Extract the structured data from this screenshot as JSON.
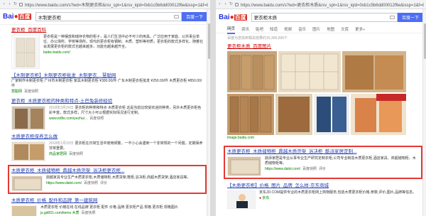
{
  "left": {
    "url": "https://www.baidu.com/s?wd=木制更衣柜&rsv_spt=1&rsv_iqid=0xb1c5b6dd00012f6e&issp=1&f=8&rsv_bp=1&rsv_idx=2",
    "logo_text": "Bai",
    "logo_du": "百度",
    "query": "木制更衣柜",
    "search_btn": "百度一下",
    "results": [
      {
        "title": "更衣柜_百度百科",
        "text": "更衣柜是一种摆放和储存衣物的柜子，是人们生活中必不可少的用具。广泛应用于家庭、公共事业单位、办公场所、学校等场所。现代的更衣柜有钢制、木质、塑料等材质，更衣柜的款式多样化，随着社会发展更衣柜的款式也越来越多，功能也越来越齐全。",
        "url": "baike.baidu.com/"
      },
      {
        "title": "【木制更衣柜】木制更衣柜批发_木制更衣... 慧聪网",
        "text": "广家制作木制更衣柜 广州市木制更衣柜 家具木制更衣柜 ¥300.00/件 广东木制更衣柜批发 ¥250.00/件 木质更衣柜 ¥850.00/件",
        "url": "慧聪网",
        "snap": "百度快照"
      },
      {
        "title": "更衣柜_木质更衣柜的种类和特点-土巴兔装修经验",
        "date": "2018年3月24日",
        "text": "更衣柜的种类和特点 木质更衣柜 这是当前比较受欢迎的种类，另外木质更衣柜色彩丰富，款式多样，尺寸大小可以根据实际情况进行定制。",
        "url": "www.to8to.com/yezhu/...",
        "snap": "百度快照"
      },
      {
        "title": "木质更衣柜保养怎么做",
        "date": "2018年1月23日",
        "text": "更衣柜在日常生活中使用频繁，一不小心会遇到一个非常规的一个问题，定期保养非常重要。",
        "url": "商品家居网",
        "snap": "百度快照"
      },
      {
        "title": "木质更衣柜_木质储物柜_鼎越木质货架_浴决柜更衣柜...",
        "text": "鼎越家具专业生产木质更衣柜,木质储物柜,木质货架,鞋柜,浴决柜,商超木质货架,酒店家具等。",
        "url": "https://www.dalot.com/",
        "snap": "百度快照",
        "extra": "评价"
      },
      {
        "title": "木质更衣柜_价格_配件和品牌_第一建筑网",
        "text": "木质更衣柜 价格在线 在线品牌 更衣柜 配件 价格 品牌 更衣柜产品 规格 更衣柜 规格图片",
        "url": "js.gd001.com/items 木质",
        "snap": "百度快照"
      }
    ]
  },
  "right": {
    "url": "https://www.baidu.com/s?wd=更衣柜木质&rsv_spt=1&rsv_iqid=0xb1c5b6dd00012f6e&issp=1&f=8&rsv_bp=1",
    "logo_text": "Bai",
    "logo_du": "百度",
    "query": "更衣柜木质",
    "search_btn": "百度一下",
    "tabs": [
      "网页",
      "资讯",
      "贴吧",
      "知道",
      "视频",
      "音乐",
      "图片",
      "地图",
      "文库",
      "更多»"
    ],
    "result_count": "百度为您找到相关结果约16,300,000个",
    "img_title": "更衣柜木质_百度图片",
    "img_source": "image.baidu.com",
    "results": [
      {
        "title": "木质更衣柜_木质储物柜_鼎越木质货架_浴决柜_酷派家居定制...",
        "text": "鼎添家居是专业从事专业生产研究定制衣柜,公司专业制造木质更衣柜,酒店家具、商超储物柜、木质储物柜等。",
        "url": "https://www.dalot.com/",
        "snap": "百度快照",
        "extra": "评价"
      },
      {
        "title": "【木质更衣柜】价格_图片_品牌_怎么样-京东商城",
        "text": "京东JD.COM提供专业的木质更衣柜网上购物服务,包括木质更衣柜价格,参数,评价,图片,品牌等信息。",
        "url": "京东"
      }
    ]
  },
  "colors": {
    "link": "#2440b3",
    "highlight": "#e53935",
    "green": "#008000",
    "brand_blue": "#4e6ef2"
  }
}
